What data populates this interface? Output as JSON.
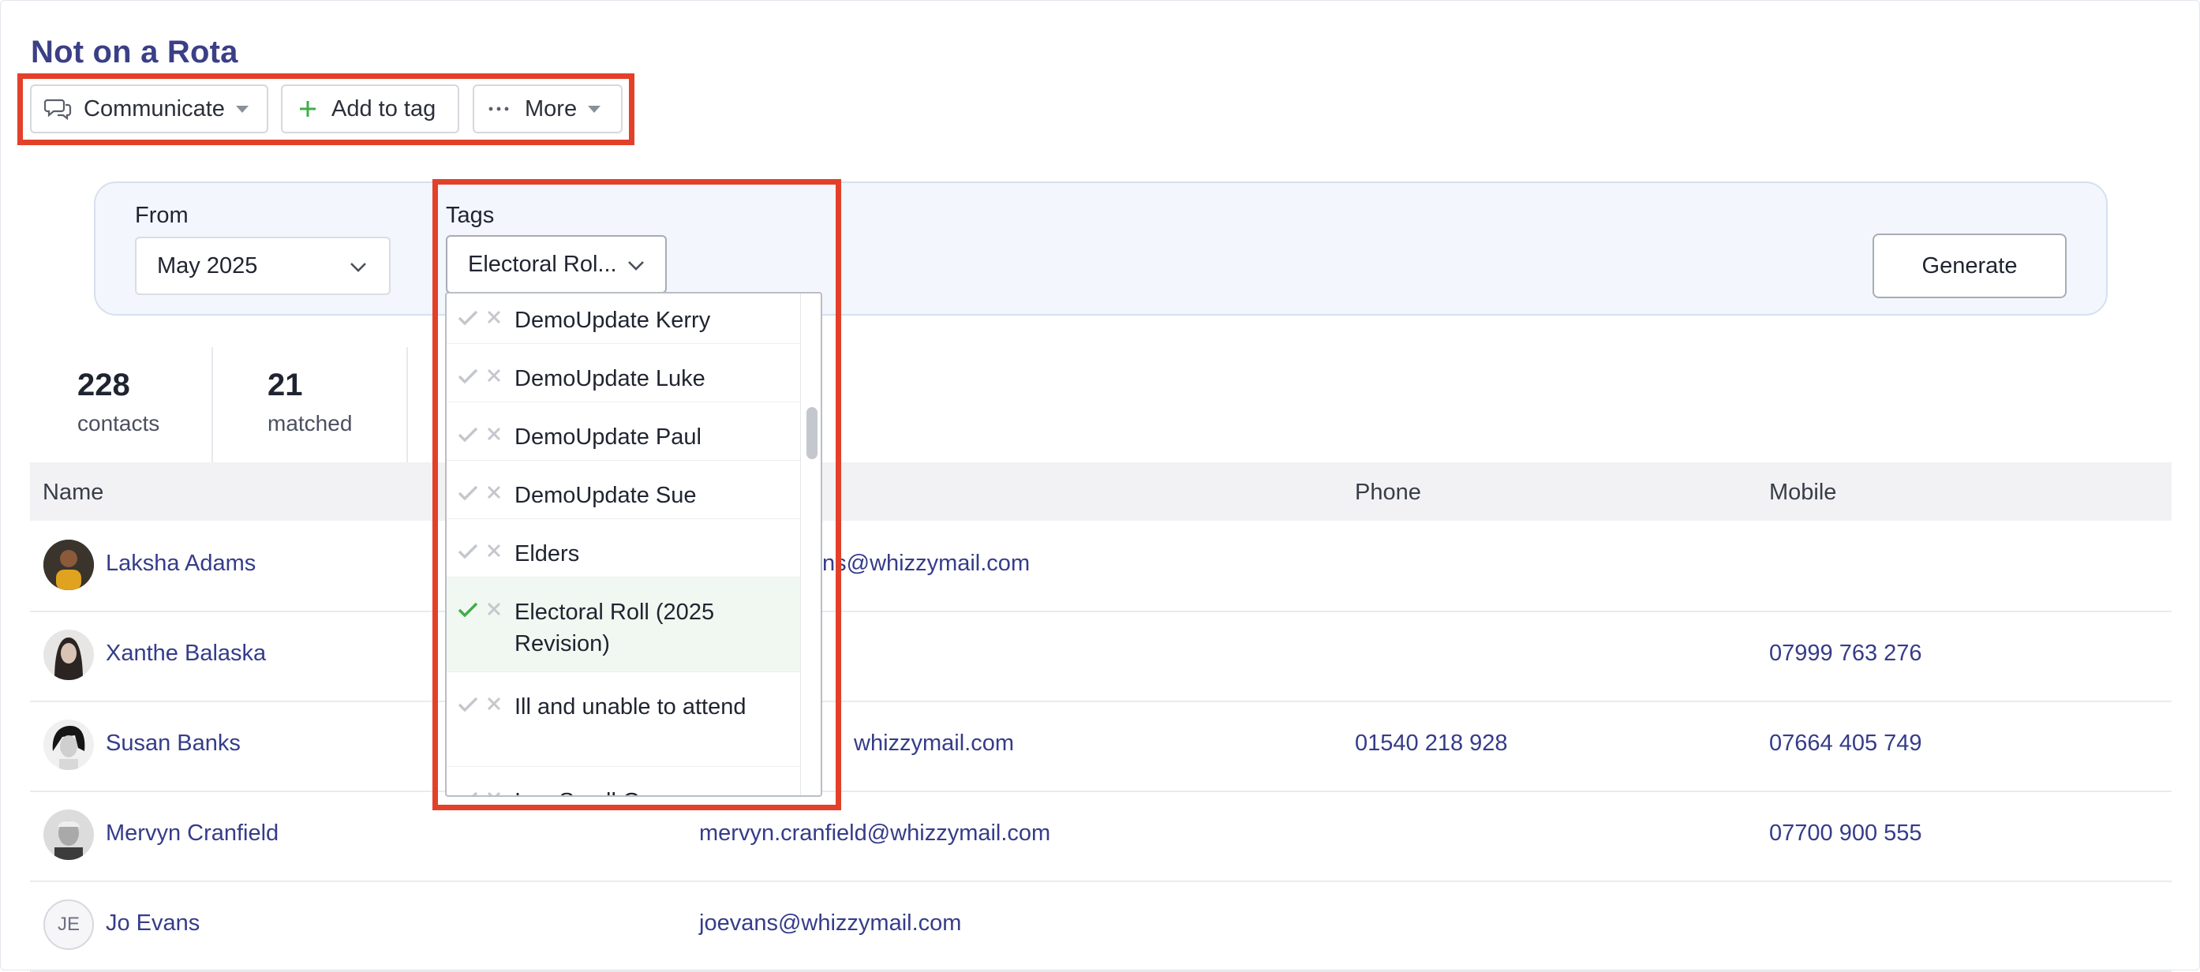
{
  "page": {
    "title": "Not on a Rota"
  },
  "toolbar": {
    "communicate_label": "Communicate",
    "add_to_tag_label": "Add to tag",
    "more_label": "More"
  },
  "filters": {
    "from_label": "From",
    "from_value": "May 2025",
    "tags_label": "Tags",
    "tags_value": "Electoral Rol...",
    "generate_label": "Generate"
  },
  "stats": {
    "contacts_value": "228",
    "contacts_label": "contacts",
    "matched_value": "21",
    "matched_label": "matched"
  },
  "table": {
    "headers": {
      "name": "Name",
      "phone": "Phone",
      "mobile": "Mobile"
    },
    "rows": [
      {
        "name": "Laksha Adams",
        "email": "ns@whizzymail.com",
        "phone": "",
        "mobile": ""
      },
      {
        "name": "Xanthe Balaska",
        "email": "",
        "phone": "",
        "mobile": "07999 763 276"
      },
      {
        "name": "Susan Banks",
        "email": "whizzymail.com",
        "phone": "01540 218 928",
        "mobile": "07664 405 749"
      },
      {
        "name": "Mervyn Cranfield",
        "email": "mervyn.cranfield@whizzymail.com",
        "phone": "",
        "mobile": "07700 900 555"
      },
      {
        "name": "Jo Evans",
        "initials": "JE",
        "email": "joevans@whizzymail.com",
        "phone": "",
        "mobile": ""
      }
    ]
  },
  "tag_options": [
    {
      "label": "DemoUpdate Kerry",
      "selected": false
    },
    {
      "label": "DemoUpdate Luke",
      "selected": false
    },
    {
      "label": "DemoUpdate Paul",
      "selected": false
    },
    {
      "label": "DemoUpdate Sue",
      "selected": false
    },
    {
      "label": "Elders",
      "selected": false
    },
    {
      "label": "Electoral Roll (2025 Revision)",
      "selected": true
    },
    {
      "label": "Ill and unable to attend",
      "selected": false
    },
    {
      "label": "In a Small Group",
      "selected": false
    }
  ],
  "colors": {
    "highlight": "#e3402a",
    "link": "#353c8a",
    "title": "#3b3f86",
    "check_selected": "#3fae49",
    "add_plus": "#3fae49"
  },
  "icons": {
    "communicate": "chat-bubbles-icon",
    "add": "plus-icon",
    "more": "ellipsis-icon",
    "dropdown": "chevron-down-icon",
    "check": "check-icon",
    "remove": "x-icon"
  }
}
